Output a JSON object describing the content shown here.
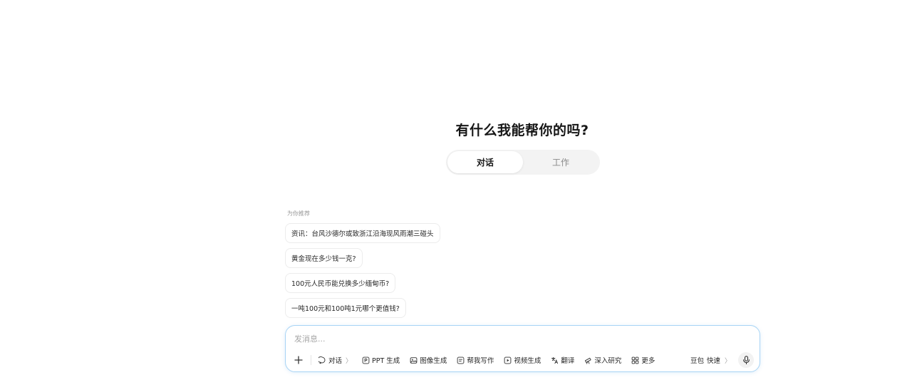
{
  "headline": "有什么我能帮你的吗?",
  "mode_tabs": [
    {
      "label": "对话",
      "active": true
    },
    {
      "label": "工作",
      "active": false
    }
  ],
  "recommendations": {
    "label": "为你推荐",
    "items": [
      "资讯：台风沙德尔或致浙江沿海现风雨潮三碰头",
      "黄金现在多少钱一克?",
      "100元人民币能兑换多少缅甸币?",
      "一吨100元和100吨1元哪个更值钱?"
    ]
  },
  "composer": {
    "placeholder": "发消息...",
    "value": "",
    "tools": {
      "chat": "对话",
      "ppt": "PPT 生成",
      "image": "图像生成",
      "write": "帮我写作",
      "video": "视频生成",
      "translate": "翻译",
      "research": "深入研究",
      "more": "更多"
    },
    "chevron": "〉",
    "model_name": "豆包",
    "model_mode": "快速",
    "border_color": "#a8d4f5"
  }
}
